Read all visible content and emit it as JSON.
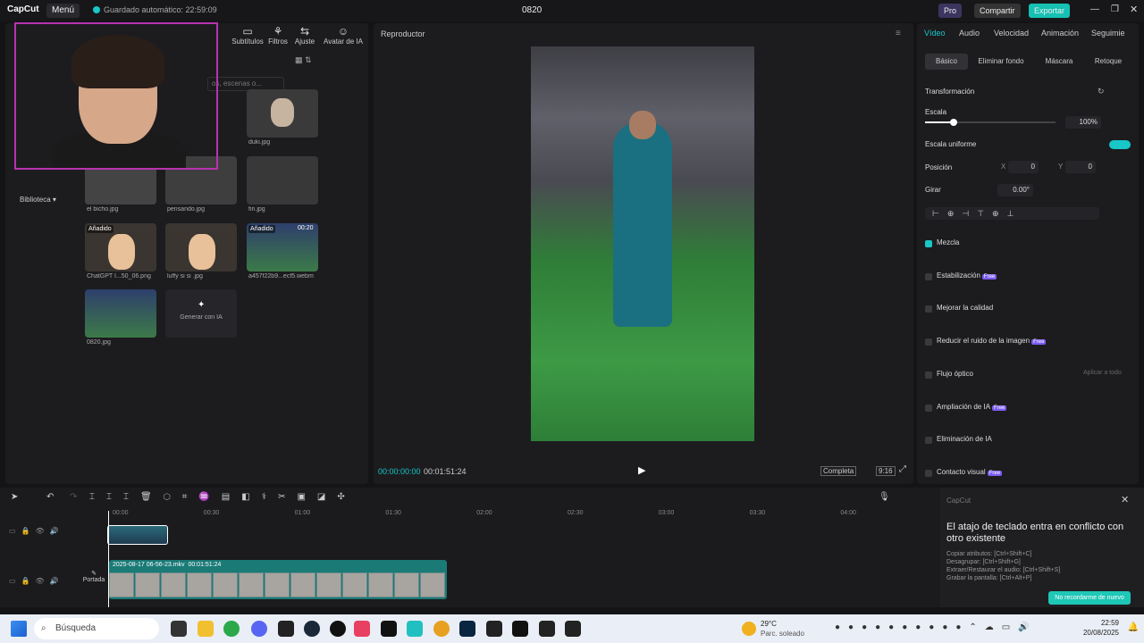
{
  "titlebar": {
    "logo": "CapCut",
    "menu": "Menú",
    "saved": "Guardado automático: 22:59:09",
    "project": "0820",
    "pro": "Pro",
    "share": "Compartir",
    "export": "Exportar"
  },
  "media": {
    "tools": [
      "Subtítulos",
      "Filtros",
      "Ajuste",
      "Avatar de IA"
    ],
    "search_placeholder": "os, escenas o...",
    "library": "Biblioteca",
    "items": [
      {
        "name": "duki.jpg",
        "badge": ""
      },
      {
        "name": "el bicho.jpg",
        "badge": ""
      },
      {
        "name": "pensando.jpg",
        "badge": ""
      },
      {
        "name": "fin.jpg",
        "badge": ""
      },
      {
        "name": "ChatGPT I...50_06.png",
        "badge": "Añadido"
      },
      {
        "name": "luffy si si .jpg",
        "badge": ""
      },
      {
        "name": "a457f22b9...ecf5.webm",
        "badge": "Añadido",
        "duration": "00:20"
      },
      {
        "name": "0820.jpg",
        "badge": ""
      }
    ],
    "generate": "Generar con IA"
  },
  "player": {
    "title": "Reproductor",
    "time_current": "00:00:00:00",
    "time_total": "00:01:51:24",
    "mode": "Completa",
    "ratio": "9:16"
  },
  "properties": {
    "tabs": [
      "Vídeo",
      "Audio",
      "Velocidad",
      "Animación",
      "Seguimie"
    ],
    "subtabs": [
      "Básico",
      "Eliminar fondo",
      "Máscara",
      "Retoque"
    ],
    "transform": "Transformación",
    "scale_label": "Escala",
    "scale_value": "100%",
    "scale_fraction": 0.22,
    "uniform_scale": "Escala uniforme",
    "position_label": "Posición",
    "x_label": "X",
    "x_value": "0",
    "y_label": "Y",
    "y_value": "0",
    "rotate_label": "Girar",
    "rotate_value": "0.00°",
    "sections": [
      {
        "label": "Mezcla",
        "badge": "",
        "checked": true
      },
      {
        "label": "Estabilización",
        "badge": "Free"
      },
      {
        "label": "Mejorar la calidad",
        "badge": ""
      },
      {
        "label": "Reducir el ruido de la imagen",
        "badge": "Free"
      },
      {
        "label": "Flujo óptico",
        "badge": "",
        "action": "Aplicar a todo"
      },
      {
        "label": "Ampliación de IA",
        "badge": "Free"
      },
      {
        "label": "Eliminación de IA",
        "badge": ""
      },
      {
        "label": "Contacto visual",
        "badge": "Free"
      }
    ]
  },
  "timeline": {
    "ruler": [
      "00:00",
      "00:30",
      "01:00",
      "01:30",
      "02:00",
      "02:30",
      "03:00",
      "03:30",
      "04:00"
    ],
    "clip_label": "2025-08-17 06-56-23.mkv",
    "clip_duration": "00:01:51:24",
    "cover": "Portada"
  },
  "notice": {
    "brand": "CapCut",
    "title": "El atajo de teclado entra en conflicto con otro existente",
    "lines": [
      "Copiar atributos: [Ctrl+Shift+C]",
      "Desagrupar: [Ctrl+Shift+G]",
      "Extraer/Restaurar el audio: [Ctrl+Shift+S]",
      "Grabar la pantalla: [Ctrl+Alt+P]"
    ],
    "button": "No recordarme de nuevo"
  },
  "taskbar": {
    "search": "Búsqueda",
    "weather_temp": "29°C",
    "weather_desc": "Parc. soleado",
    "time": "22:59",
    "date": "20/08/2025"
  }
}
